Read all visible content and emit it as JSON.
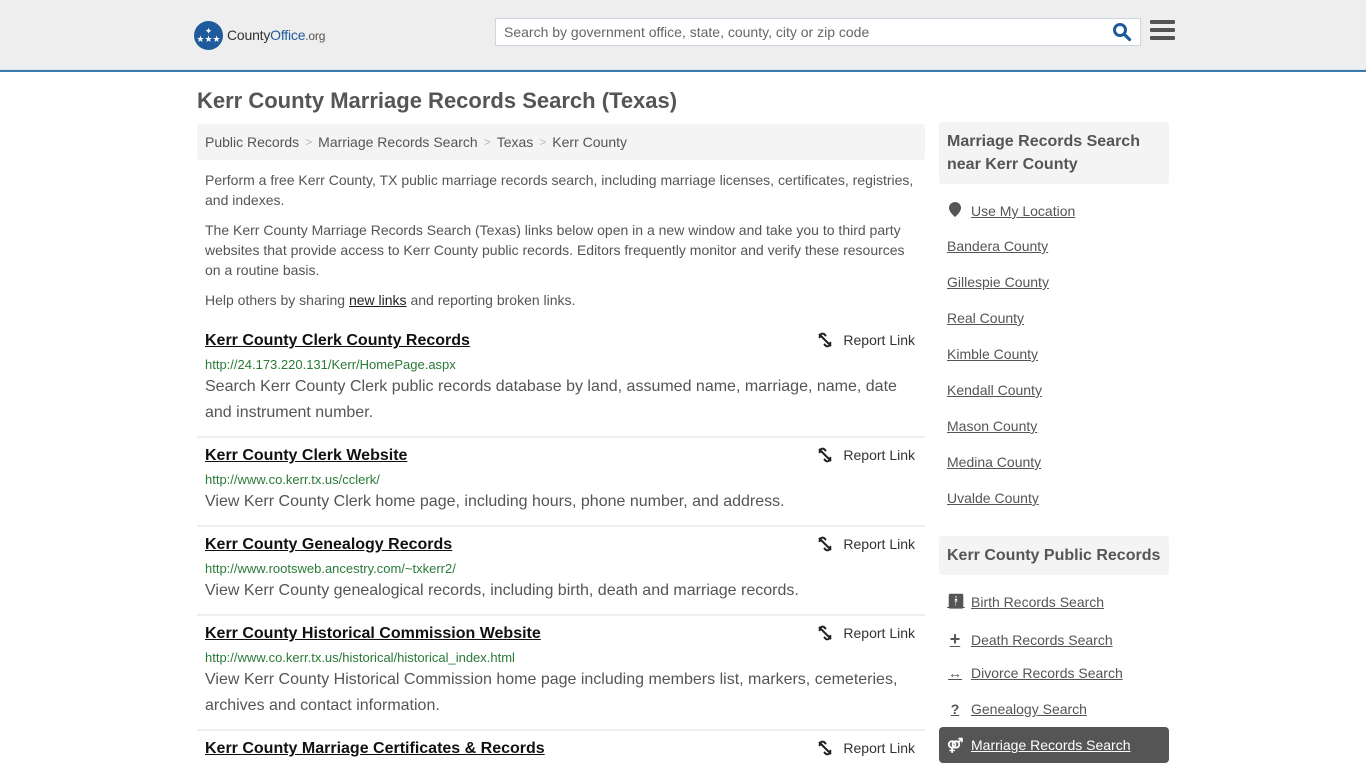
{
  "header": {
    "logo": {
      "name_part1": "County",
      "name_part2": "Office",
      "name_suffix": ".org"
    },
    "search": {
      "placeholder": "Search by government office, state, county, city or zip code",
      "value": ""
    },
    "colors": {
      "brand": "#1f5b9c",
      "accent_border": "#3a7aab"
    }
  },
  "page": {
    "title": "Kerr County Marriage Records Search (Texas)",
    "breadcrumb": [
      "Public Records",
      "Marriage Records Search",
      "Texas",
      "Kerr County"
    ],
    "intro": {
      "p1": "Perform a free Kerr County, TX public marriage records search, including marriage licenses, certificates, registries, and indexes.",
      "p2": "The Kerr County Marriage Records Search (Texas) links below open in a new window and take you to third party websites that provide access to Kerr County public records. Editors frequently monitor and verify these resources on a routine basis.",
      "p3_before": "Help others by sharing ",
      "p3_link": "new links",
      "p3_after": " and reporting broken links."
    }
  },
  "results": [
    {
      "title": "Kerr County Clerk County Records",
      "url": "http://24.173.220.131/Kerr/HomePage.aspx",
      "desc": "Search Kerr County Clerk public records database by land, assumed name, marriage, name, date and instrument number.",
      "report_label": "Report Link"
    },
    {
      "title": "Kerr County Clerk Website",
      "url": "http://www.co.kerr.tx.us/cclerk/",
      "desc": "View Kerr County Clerk home page, including hours, phone number, and address.",
      "report_label": "Report Link"
    },
    {
      "title": "Kerr County Genealogy Records",
      "url": "http://www.rootsweb.ancestry.com/~txkerr2/",
      "desc": "View Kerr County genealogical records, including birth, death and marriage records.",
      "report_label": "Report Link"
    },
    {
      "title": "Kerr County Historical Commission Website",
      "url": "http://www.co.kerr.tx.us/historical/historical_index.html",
      "desc": "View Kerr County Historical Commission home page including members list, markers, cemeteries, archives and contact information.",
      "report_label": "Report Link"
    },
    {
      "title": "Kerr County Marriage Certificates & Records",
      "url": "",
      "desc": "",
      "report_label": "Report Link"
    }
  ],
  "sidebar": {
    "nearby": {
      "heading": "Marriage Records Search near Kerr County",
      "use_location": "Use My Location",
      "counties": [
        "Bandera County",
        "Gillespie County",
        "Real County",
        "Kimble County",
        "Kendall County",
        "Mason County",
        "Medina County",
        "Uvalde County"
      ]
    },
    "public_records": {
      "heading": "Kerr County Public Records",
      "items": [
        {
          "label": "Birth Records Search",
          "icon": "child-icon"
        },
        {
          "label": "Death Records Search",
          "icon": "cross-icon"
        },
        {
          "label": "Divorce Records Search",
          "icon": "arrows-horizontal-icon"
        },
        {
          "label": "Genealogy Search",
          "icon": "question-icon"
        },
        {
          "label": "Marriage Records Search",
          "icon": "gender-rings-icon",
          "active": true
        }
      ]
    }
  }
}
